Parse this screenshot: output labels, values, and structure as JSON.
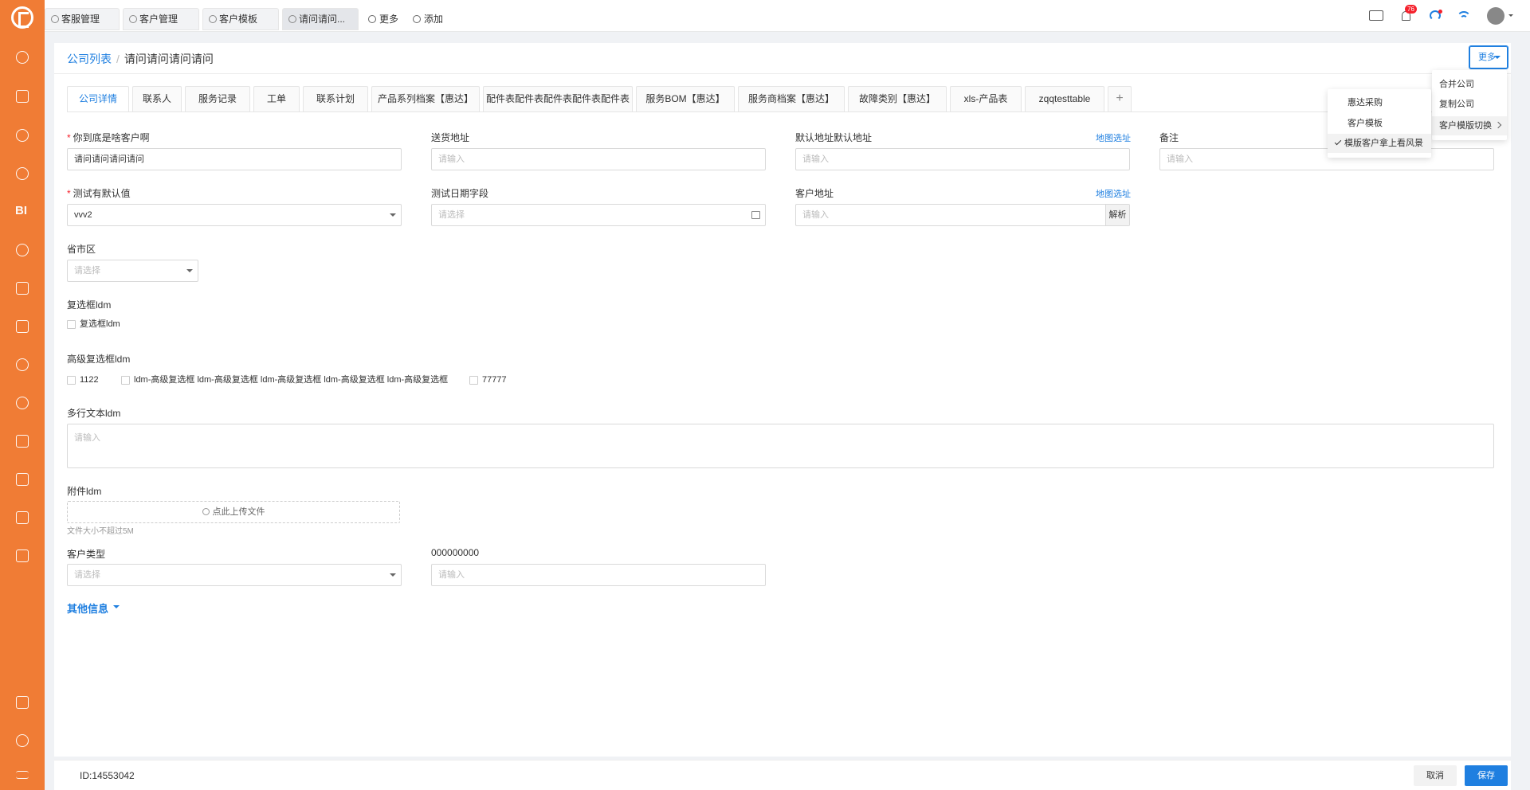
{
  "top_tabs": [
    {
      "label": "客服管理",
      "icon": "gear-icon"
    },
    {
      "label": "客户管理",
      "icon": "user-icon"
    },
    {
      "label": "客户模板",
      "icon": "user-icon"
    },
    {
      "label": "请问请问...",
      "icon": "user-icon"
    }
  ],
  "top_links": {
    "more": "更多",
    "add": "添加"
  },
  "notification_count": "76",
  "breadcrumb": {
    "parent": "公司列表",
    "sep": "/",
    "current": "请问请问请问请问"
  },
  "more_button": "更多",
  "content_tabs": [
    "公司详情",
    "联系人",
    "服务记录",
    "工单",
    "联系计划",
    "产品系列档案【惠达】",
    "配件表配件表配件表配件表配件表",
    "服务BOM【惠达】",
    "服务商档案【惠达】",
    "故障类别【惠达】",
    "xls-产品表",
    "zqqtesttable"
  ],
  "form": {
    "customer_label": "你到底是啥客户啊",
    "customer_value": "请问请问请问请问",
    "delivery_label": "送货地址",
    "delivery_placeholder": "请输入",
    "default_addr_label": "默认地址默认地址",
    "default_addr_placeholder": "请输入",
    "map_select": "地图选址",
    "remark_label": "备注",
    "remark_placeholder": "请输入",
    "test_default_label": "测试有默认值",
    "test_default_value": "vvv2",
    "test_date_label": "测试日期字段",
    "test_date_placeholder": "请选择",
    "cust_addr_label": "客户地址",
    "cust_addr_placeholder": "请输入",
    "parse_button": "解析",
    "region_label": "省市区",
    "region_placeholder": "请选择",
    "checkbox_label": "复选框ldm",
    "checkbox_option": "复选框ldm",
    "adv_checkbox_label": "高级复选框ldm",
    "adv_options": [
      "1122",
      "ldm-高级复选框 ldm-高级复选框 ldm-高级复选框 ldm-高级复选框 ldm-高级复选框",
      "77777"
    ],
    "multiline_label": "多行文本ldm",
    "multiline_placeholder": "请输入",
    "attach_label": "附件ldm",
    "upload_text": "点此上传文件",
    "upload_hint": "文件大小不超过5M",
    "cust_type_label": "客户类型",
    "cust_type_placeholder": "请选择",
    "zeros_label": "000000000",
    "zeros_placeholder": "请输入",
    "other_info": "其他信息"
  },
  "more_menu": [
    "合并公司",
    "复制公司",
    "客户模版切换"
  ],
  "template_menu": [
    "惠达采购",
    "客户模板",
    "模版客户拿上看风景"
  ],
  "footer": {
    "id_text": "ID:14553042",
    "cancel": "取消",
    "save": "保存"
  },
  "colors": {
    "sidebar": "#f07c35",
    "accent": "#1f7fe0",
    "required": "#f5222d"
  }
}
